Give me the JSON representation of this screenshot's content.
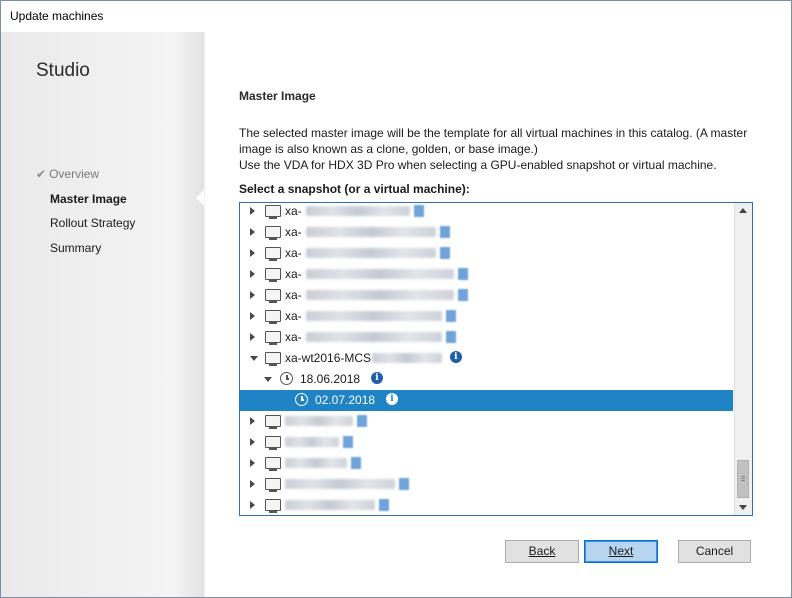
{
  "window": {
    "title": "Update machines"
  },
  "sidebar": {
    "app_title": "Studio",
    "check_glyph": "✔",
    "items": [
      {
        "label": "Overview",
        "state": "done"
      },
      {
        "label": "Master Image",
        "state": "active"
      },
      {
        "label": "Rollout Strategy",
        "state": "pending"
      },
      {
        "label": "Summary",
        "state": "pending"
      }
    ]
  },
  "main": {
    "heading": "Master Image",
    "description_1": "The selected master image will be the template for all virtual machines in this catalog. (A master image is also known as a clone, golden, or base image.)",
    "description_2": "Use the VDA for HDX 3D Pro when selecting a GPU-enabled snapshot or virtual machine.",
    "select_label": "Select a snapshot (or a virtual machine):",
    "tree": {
      "rows": [
        {
          "type": "vm",
          "label": "xa-",
          "state": "collapsed",
          "redacted": true
        },
        {
          "type": "vm",
          "label": "xa-",
          "state": "collapsed",
          "redacted": true
        },
        {
          "type": "vm",
          "label": "xa-",
          "state": "collapsed",
          "redacted": true
        },
        {
          "type": "vm",
          "label": "xa-",
          "state": "collapsed",
          "redacted": true
        },
        {
          "type": "vm",
          "label": "xa-",
          "state": "collapsed",
          "redacted": true
        },
        {
          "type": "vm",
          "label": "xa-",
          "state": "collapsed",
          "redacted": true
        },
        {
          "type": "vm",
          "label": "xa-",
          "state": "collapsed",
          "redacted": true
        },
        {
          "type": "vm",
          "label": "xa-wt2016-MCS",
          "state": "expanded",
          "redacted": true,
          "info": true
        },
        {
          "type": "snapshot",
          "label": "18.06.2018",
          "state": "expanded",
          "info": true
        },
        {
          "type": "snapshot",
          "label": "02.07.2018",
          "state": "leaf",
          "info": true,
          "selected": true
        },
        {
          "type": "vm",
          "label": "",
          "state": "collapsed",
          "redacted": true
        },
        {
          "type": "vm",
          "label": "",
          "state": "collapsed",
          "redacted": true
        },
        {
          "type": "vm",
          "label": "",
          "state": "collapsed",
          "redacted": true
        },
        {
          "type": "vm",
          "label": "",
          "state": "collapsed",
          "redacted": true
        },
        {
          "type": "vm",
          "label": "",
          "state": "collapsed",
          "redacted": true
        }
      ]
    }
  },
  "buttons": {
    "back": "Back",
    "next": "Next",
    "cancel": "Cancel"
  },
  "colors": {
    "selection": "#1e84c6",
    "info_icon": "#1e5fa8",
    "tree_border": "#2d6fb3",
    "primary_button_border": "#0078d7"
  }
}
